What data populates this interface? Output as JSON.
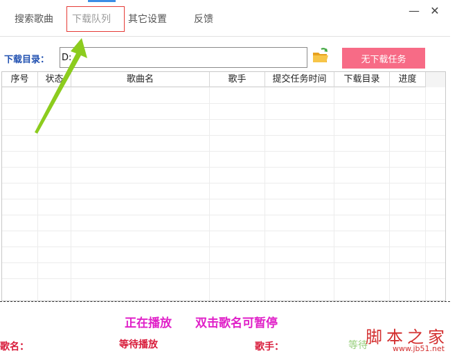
{
  "tabs": [
    {
      "label": "搜索歌曲"
    },
    {
      "label": "下载队列"
    },
    {
      "label": "其它设置"
    },
    {
      "label": "反馈"
    }
  ],
  "window_controls": {
    "minimize": "—",
    "close": "✕"
  },
  "download_dir": {
    "label": "下载目录：",
    "value": "D:"
  },
  "task_button": {
    "label": "无下载任务"
  },
  "table": {
    "columns": [
      "序号",
      "状态",
      "歌曲名",
      "歌手",
      "提交任务时间",
      "下载目录",
      "进度"
    ],
    "rows": []
  },
  "player": {
    "now_playing": "正在播放",
    "hint": "双击歌名可暂停",
    "song_label": "歌名：",
    "song_value": "等待播放",
    "singer_label": "歌手：",
    "status_faded": "等待"
  },
  "watermark": {
    "brand": "脚本之家",
    "url": "www.jb51.net"
  },
  "colors": {
    "accent": "#3a8ee6",
    "highlight": "#e53935",
    "task_button": "#f76b86",
    "player_text": "#e020c8",
    "label_text": "#d81b3a",
    "arrow": "#8ccc1e"
  },
  "icons": {
    "folder": "folder-open-icon",
    "arrow": "annotation-arrow"
  }
}
